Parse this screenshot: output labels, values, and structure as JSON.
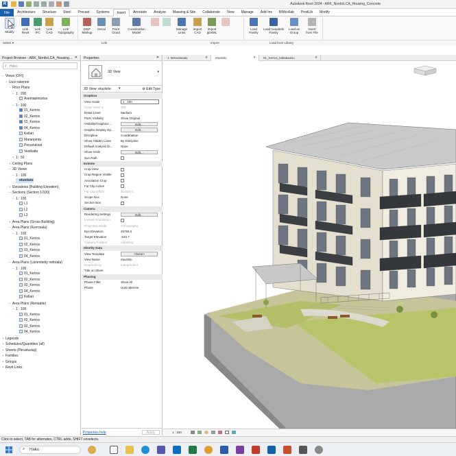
{
  "app": {
    "title": "Autodesk Revit 2024 - ARK_NordicLCA_Housing_Concrete",
    "colors": {
      "accent": "#1a5faa",
      "selection": "#cfe3f8"
    }
  },
  "menu": {
    "file": "File",
    "tabs": [
      "Architecture",
      "Structure",
      "Steel",
      "Precast",
      "Systems",
      "Insert",
      "Annotate",
      "Analyze",
      "Massing & Site",
      "Collaborate",
      "View",
      "Manage",
      "Add-Ins",
      "BIMcollab",
      "ProdLib",
      "Modify"
    ],
    "active": "Insert"
  },
  "ribbon": {
    "buttons": [
      {
        "label": "Modify",
        "icon": "cursor-icon",
        "dim": false
      },
      {
        "label": "Link\nRevit",
        "icon": "link-revit-icon",
        "dim": false
      },
      {
        "label": "Link\nIFC",
        "icon": "link-ifc-icon",
        "dim": false
      },
      {
        "label": "Link\nCAD",
        "icon": "link-cad-icon",
        "dim": false
      },
      {
        "label": "Link\nTopography",
        "icon": "link-topography-icon",
        "dim": false
      },
      {
        "label": "DWF\nMarkup",
        "icon": "dwf-markup-icon",
        "dim": false
      },
      {
        "label": "Decal",
        "icon": "decal-icon",
        "dim": false
      },
      {
        "label": "Point\nCloud",
        "icon": "point-cloud-icon",
        "dim": false
      },
      {
        "label": "Coordination\nModel",
        "icon": "coordination-model-icon",
        "dim": false
      },
      {
        "label": "",
        "icon": "link-pdf-icon",
        "dim": true
      },
      {
        "label": "",
        "icon": "link-image-icon",
        "dim": true
      },
      {
        "label": "Manage\nLinks",
        "icon": "manage-links-icon",
        "dim": false
      },
      {
        "label": "Import\nCAD",
        "icon": "import-cad-icon",
        "dim": false
      },
      {
        "label": "Import\ngbXML",
        "icon": "import-gbxml-icon",
        "dim": false
      },
      {
        "label": "",
        "icon": "import-pdf-icon",
        "dim": true
      },
      {
        "label": "Load\nFamily",
        "icon": "load-family-icon",
        "dim": false
      },
      {
        "label": "Load Autodesk\nFamily",
        "icon": "load-autodesk-family-icon",
        "dim": false
      },
      {
        "label": "Load as\nGroup",
        "icon": "load-as-group-icon",
        "dim": false
      },
      {
        "label": "Insert\nfrom File",
        "icon": "insert-from-file-icon",
        "dim": false
      }
    ],
    "panels": {
      "select": "Select ▾",
      "link": "Link",
      "import": "Import",
      "load": "Load from Library"
    }
  },
  "project_browser": {
    "title": "Project Browser - ARK_NordicLCA_Housing...",
    "search_placeholder": "Haku",
    "tree": [
      {
        "label": "Views (OFI)",
        "indent": 0,
        "toggle": "−",
        "icon": false
      },
      {
        "label": "Uusi rakenne",
        "indent": 1,
        "toggle": "−",
        "icon": false
      },
      {
        "label": "Floor Plans",
        "indent": 2,
        "toggle": "−",
        "icon": false
      },
      {
        "label": "1 : 200",
        "indent": 3,
        "toggle": "−",
        "icon": false
      },
      {
        "label": "Asemapiirustus",
        "indent": 4,
        "toggle": "",
        "icon": true
      },
      {
        "label": "1 : 100",
        "indent": 3,
        "toggle": "−",
        "icon": false
      },
      {
        "label": "01_Kerros",
        "indent": 4,
        "toggle": "",
        "icon": true
      },
      {
        "label": "02_Kerros",
        "indent": 4,
        "toggle": "",
        "icon": true
      },
      {
        "label": "03_Kerros",
        "indent": 4,
        "toggle": "",
        "icon": true
      },
      {
        "label": "04_Kerros",
        "indent": 4,
        "toggle": "",
        "icon": true
      },
      {
        "label": "Kellari",
        "indent": 4,
        "toggle": "",
        "icon": true
      },
      {
        "label": "Maranpinta",
        "indent": 4,
        "toggle": "",
        "icon": true
      },
      {
        "label": "Perustukset",
        "indent": 4,
        "toggle": "",
        "icon": true
      },
      {
        "label": "Vesikatto",
        "indent": 4,
        "toggle": "",
        "icon": true
      },
      {
        "label": "1 : 50",
        "indent": 3,
        "toggle": "+",
        "icon": false
      },
      {
        "label": "Ceiling Plans",
        "indent": 2,
        "toggle": "+",
        "icon": false
      },
      {
        "label": "3D Views",
        "indent": 2,
        "toggle": "−",
        "icon": false
      },
      {
        "label": "1 : 100",
        "indent": 3,
        "toggle": "−",
        "icon": false
      },
      {
        "label": "etuviisto",
        "indent": 4,
        "toggle": "",
        "icon": false,
        "bold": true
      },
      {
        "label": "Elevations (Building Elevation)",
        "indent": 2,
        "toggle": "+",
        "icon": false
      },
      {
        "label": "Sections (Section 1/100)",
        "indent": 2,
        "toggle": "−",
        "icon": false
      },
      {
        "label": "1 : 100",
        "indent": 3,
        "toggle": "−",
        "icon": false
      },
      {
        "label": "L1",
        "indent": 4,
        "toggle": "",
        "icon": true
      },
      {
        "label": "L2",
        "indent": 4,
        "toggle": "",
        "icon": true
      },
      {
        "label": "L3",
        "indent": 4,
        "toggle": "",
        "icon": true
      },
      {
        "label": "Area Plans (Gross Building)",
        "indent": 2,
        "toggle": "+",
        "icon": false
      },
      {
        "label": "Area Plans (Kerrosala)",
        "indent": 2,
        "toggle": "−",
        "icon": false
      },
      {
        "label": "1 : 100",
        "indent": 3,
        "toggle": "−",
        "icon": false
      },
      {
        "label": "01_Kerros",
        "indent": 4,
        "toggle": "",
        "icon": true
      },
      {
        "label": "02_Kerros",
        "indent": 4,
        "toggle": "",
        "icon": true
      },
      {
        "label": "03_Kerros",
        "indent": 4,
        "toggle": "",
        "icon": true
      },
      {
        "label": "04_Kerros",
        "indent": 4,
        "toggle": "",
        "icon": true
      },
      {
        "label": "Area Plans (Lämmitetty nettoala)",
        "indent": 2,
        "toggle": "−",
        "icon": false
      },
      {
        "label": "1 : 100",
        "indent": 3,
        "toggle": "−",
        "icon": false
      },
      {
        "label": "01_Kerros",
        "indent": 4,
        "toggle": "",
        "icon": true
      },
      {
        "label": "02_Kerros",
        "indent": 4,
        "toggle": "",
        "icon": true
      },
      {
        "label": "03_Kerros",
        "indent": 4,
        "toggle": "",
        "icon": true
      },
      {
        "label": "04_Kerros",
        "indent": 4,
        "toggle": "",
        "icon": true
      },
      {
        "label": "Kellari",
        "indent": 4,
        "toggle": "",
        "icon": true
      },
      {
        "label": "Area Plans (Rentable)",
        "indent": 2,
        "toggle": "−",
        "icon": false
      },
      {
        "label": "1 : 100",
        "indent": 3,
        "toggle": "−",
        "icon": false
      },
      {
        "label": "01_Kerros",
        "indent": 4,
        "toggle": "",
        "icon": true
      },
      {
        "label": "02_Kerros",
        "indent": 4,
        "toggle": "",
        "icon": true
      },
      {
        "label": "03_Kerros",
        "indent": 4,
        "toggle": "",
        "icon": true
      },
      {
        "label": "04_Kerros",
        "indent": 4,
        "toggle": "",
        "icon": true
      },
      {
        "label": "Legends",
        "indent": 0,
        "toggle": "+",
        "icon": false
      },
      {
        "label": "Schedules/Quantities (all)",
        "indent": 0,
        "toggle": "+",
        "icon": false
      },
      {
        "label": "Sheets (Piirustuslaji)",
        "indent": 0,
        "toggle": "+",
        "icon": false
      },
      {
        "label": "Families",
        "indent": 0,
        "toggle": "+",
        "icon": false
      },
      {
        "label": "Groups",
        "indent": 0,
        "toggle": "+",
        "icon": false
      },
      {
        "label": "Revit Links",
        "indent": 0,
        "toggle": "+",
        "icon": false
      }
    ]
  },
  "properties": {
    "title": "Properties",
    "type_name": "3D View",
    "selector": "3D View: etuviisto",
    "edit_type": "Edit Type",
    "rows": [
      {
        "kind": "section",
        "k": "Graphics"
      },
      {
        "kind": "input",
        "k": "View Scale",
        "v": "1 : 100"
      },
      {
        "kind": "text",
        "k": "Scale Value    1:",
        "v": "100",
        "dim": true
      },
      {
        "kind": "text",
        "k": "Detail Level",
        "v": "Medium"
      },
      {
        "kind": "text",
        "k": "Parts Visibility",
        "v": "Show Original"
      },
      {
        "kind": "button",
        "k": "Visibility/Graphics ...",
        "v": "Edit..."
      },
      {
        "kind": "button",
        "k": "Graphic Display Op...",
        "v": "Edit..."
      },
      {
        "kind": "text",
        "k": "Discipline",
        "v": "Coordination"
      },
      {
        "kind": "text",
        "k": "Show Hidden Lines",
        "v": "By Discipline"
      },
      {
        "kind": "text",
        "k": "Default Analysis Di...",
        "v": "None"
      },
      {
        "kind": "button",
        "k": "Show Grids",
        "v": "Edit..."
      },
      {
        "kind": "check",
        "k": "Sun Path"
      },
      {
        "kind": "section",
        "k": "Extents"
      },
      {
        "kind": "check",
        "k": "Crop View"
      },
      {
        "kind": "check",
        "k": "Crop Region Visible"
      },
      {
        "kind": "check",
        "k": "Annotation Crop"
      },
      {
        "kind": "check",
        "k": "Far Clip Active"
      },
      {
        "kind": "text",
        "k": "Far Clip Offset",
        "v": "304800.0",
        "dim": true
      },
      {
        "kind": "text",
        "k": "Scope Box",
        "v": "None"
      },
      {
        "kind": "check",
        "k": "Section Box"
      },
      {
        "kind": "section",
        "k": "Camera"
      },
      {
        "kind": "button",
        "k": "Rendering Settings",
        "v": "Edit..."
      },
      {
        "kind": "check",
        "k": "Locked Orientation",
        "dim": true
      },
      {
        "kind": "text",
        "k": "Projection Mode",
        "v": "Orthographic",
        "dim": true
      },
      {
        "kind": "text",
        "k": "Eye Elevation",
        "v": "25758.0"
      },
      {
        "kind": "text",
        "k": "Target Elevation",
        "v": "-540.7"
      },
      {
        "kind": "text",
        "k": "Camera Position",
        "v": "Adjusting",
        "dim": true
      },
      {
        "kind": "section",
        "k": "Identity Data"
      },
      {
        "kind": "button",
        "k": "View Template",
        "v": "<None>"
      },
      {
        "kind": "text",
        "k": "View Name",
        "v": "etuviisto"
      },
      {
        "kind": "text",
        "k": "Dependency",
        "v": "Independent",
        "dim": true
      },
      {
        "kind": "text",
        "k": "Title on Sheet",
        "v": ""
      },
      {
        "kind": "section",
        "k": "Phasing"
      },
      {
        "kind": "text",
        "k": "Phase Filter",
        "v": "Show All"
      },
      {
        "kind": "text",
        "k": "Phase",
        "v": "Uusi rakenne"
      }
    ],
    "help": "Properties help",
    "apply": "Apply"
  },
  "view_tabs": [
    {
      "label": "1. Brevvitusalu",
      "active": false
    },
    {
      "label": "etuviisto",
      "active": true
    },
    {
      "label": "01_Kerros_lattiakaavio",
      "active": false
    }
  ],
  "view_controls": {
    "scale": "1 : 100"
  },
  "status": {
    "text": "Click to select, TAB for alternates, CTRL adds, SHIFT unselects."
  },
  "taskbar": {
    "search": "Haku"
  }
}
